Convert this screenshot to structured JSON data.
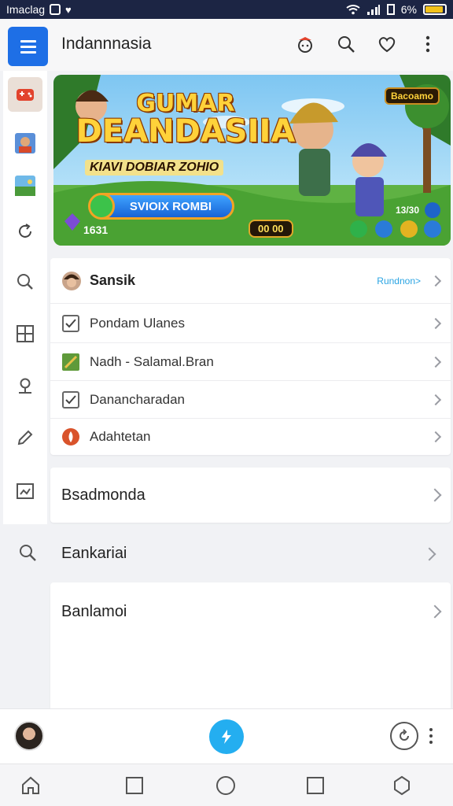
{
  "status_bar": {
    "carrier": "Imaclag",
    "battery": "6%"
  },
  "app_bar": {
    "title": "Indannnasia",
    "menu_icon": "hamburger-icon",
    "actions": [
      "game-avatar-icon",
      "search-icon",
      "heart-icon",
      "more-vertical-icon"
    ]
  },
  "sidebar": {
    "items": [
      {
        "icon": "game-controller-icon",
        "active": true
      },
      {
        "icon": "game-thumbnail-icon"
      },
      {
        "icon": "landscape-thumbnail-icon"
      },
      {
        "icon": "refresh-icon"
      },
      {
        "icon": "search-icon"
      },
      {
        "icon": "grid-icon"
      },
      {
        "icon": "location-pin-icon"
      },
      {
        "icon": "pencil-icon"
      },
      {
        "icon": "image-icon"
      }
    ]
  },
  "banner": {
    "title_line1": "GUMAR",
    "title_line2": "DEANDASIIA",
    "subtitle": "KIAVI DOBIAR ZOHIO",
    "cta": "SVIOIX ROMBI",
    "tag": "Bacoamo",
    "left_number": "1631",
    "score": "00 00",
    "count": "13/30"
  },
  "list_card": {
    "header": {
      "label": "Sansik",
      "link": "Rundnon>"
    },
    "rows": [
      {
        "label": "Pondam Ulanes",
        "icon": "checkbox-icon"
      },
      {
        "label": "Nadh - Salamal.Bran",
        "icon": "game-thumbnail-icon"
      },
      {
        "label": "Danancharadan",
        "icon": "checkbox-icon"
      },
      {
        "label": "Adahtetan",
        "icon": "orange-logo-icon"
      }
    ]
  },
  "sections": {
    "row1": "Bsadmonda",
    "row2": "Eankariai",
    "row3": "Banlamoi"
  },
  "colors": {
    "accent": "#1e6fe6",
    "fab": "#24aef0",
    "link": "#2aa4e3",
    "status_bar": "#1c2544"
  }
}
